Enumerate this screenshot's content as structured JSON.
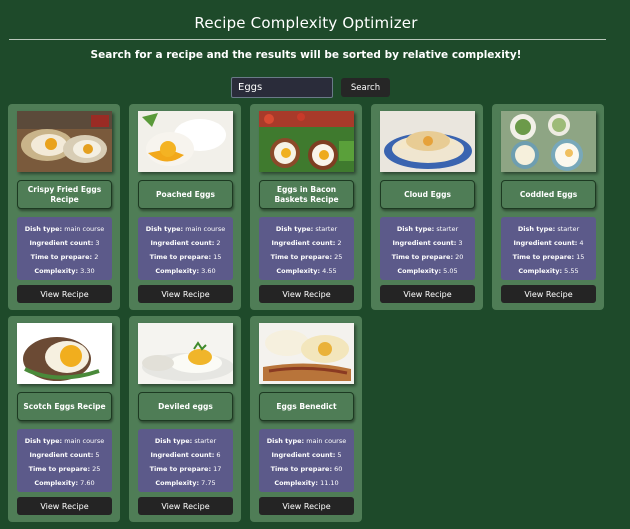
{
  "header": {
    "title": "Recipe Complexity Optimizer",
    "subtitle": "Search for a recipe and the results will be sorted by relative complexity!"
  },
  "search": {
    "value": "Eggs",
    "button_label": "Search"
  },
  "labels": {
    "dish_type": "Dish type:",
    "ingredient_count": "Ingredient count:",
    "time_to_prepare": "Time to prepare:",
    "complexity": "Complexity:"
  },
  "view_label": "View Recipe",
  "recipes": [
    {
      "name": "Crispy Fried Eggs Recipe",
      "dish_type": "main course",
      "ingredient_count": "3",
      "time": "2",
      "complexity": "3.30",
      "image": "fried-eggs-photo"
    },
    {
      "name": "Poached Eggs",
      "dish_type": "main course",
      "ingredient_count": "2",
      "time": "15",
      "complexity": "3.60",
      "image": "poached-eggs-photo"
    },
    {
      "name": "Eggs in Bacon Baskets Recipe",
      "dish_type": "starter",
      "ingredient_count": "2",
      "time": "25",
      "complexity": "4.55",
      "image": "bacon-baskets-photo"
    },
    {
      "name": "Cloud Eggs",
      "dish_type": "starter",
      "ingredient_count": "3",
      "time": "20",
      "complexity": "5.05",
      "image": "cloud-eggs-photo"
    },
    {
      "name": "Coddled Eggs",
      "dish_type": "starter",
      "ingredient_count": "4",
      "time": "15",
      "complexity": "5.55",
      "image": "coddled-eggs-photo"
    },
    {
      "name": "Scotch Eggs Recipe",
      "dish_type": "main course",
      "ingredient_count": "5",
      "time": "25",
      "complexity": "7.60",
      "image": "scotch-eggs-photo"
    },
    {
      "name": "Deviled eggs",
      "dish_type": "starter",
      "ingredient_count": "6",
      "time": "17",
      "complexity": "7.75",
      "image": "deviled-eggs-photo"
    },
    {
      "name": "Eggs Benedict",
      "dish_type": "main course",
      "ingredient_count": "5",
      "time": "60",
      "complexity": "11.10",
      "image": "eggs-benedict-photo"
    }
  ]
}
